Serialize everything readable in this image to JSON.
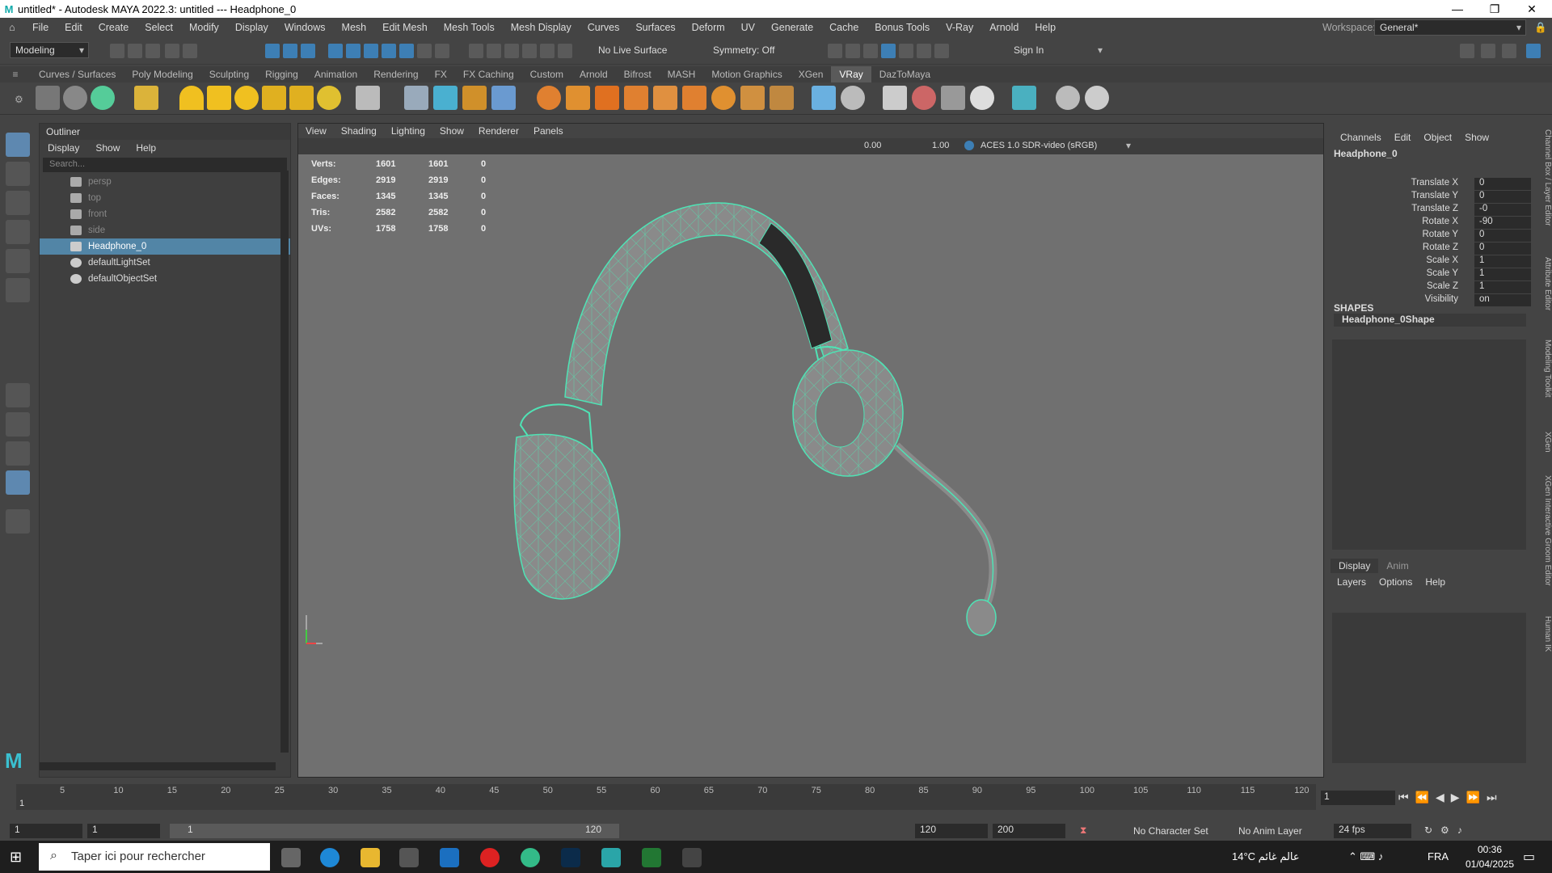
{
  "title": {
    "text": "untitled* - Autodesk MAYA 2022.3: untitled  ---  Headphone_0"
  },
  "menu": [
    "File",
    "Edit",
    "Create",
    "Select",
    "Modify",
    "Display",
    "Windows",
    "Mesh",
    "Edit Mesh",
    "Mesh Tools",
    "Mesh Display",
    "Curves",
    "Surfaces",
    "Deform",
    "UV",
    "Generate",
    "Cache",
    "Bonus Tools",
    "V-Ray",
    "Arnold",
    "Help"
  ],
  "workspace": {
    "label": "Workspace:",
    "value": "General*"
  },
  "toolbar": {
    "mode": "Modeling",
    "live_surface": "No Live Surface",
    "symmetry": "Symmetry: Off",
    "sign_in": "Sign In"
  },
  "shelf_tabs": [
    "Curves / Surfaces",
    "Poly Modeling",
    "Sculpting",
    "Rigging",
    "Animation",
    "Rendering",
    "FX",
    "FX Caching",
    "Custom",
    "Arnold",
    "Bifrost",
    "MASH",
    "Motion Graphics",
    "XGen",
    "VRay",
    "DazToMaya"
  ],
  "active_shelf": "VRay",
  "outliner": {
    "title": "Outliner",
    "menu": [
      "Display",
      "Show",
      "Help"
    ],
    "search_placeholder": "Search...",
    "items": [
      {
        "label": "persp",
        "state": "dim"
      },
      {
        "label": "top",
        "state": "dim"
      },
      {
        "label": "front",
        "state": "dim"
      },
      {
        "label": "side",
        "state": "dim"
      },
      {
        "label": "Headphone_0",
        "state": "selected"
      },
      {
        "label": "defaultLightSet",
        "state": "normal"
      },
      {
        "label": "defaultObjectSet",
        "state": "normal"
      }
    ]
  },
  "viewport": {
    "menu": [
      "View",
      "Shading",
      "Lighting",
      "Show",
      "Renderer",
      "Panels"
    ],
    "exposure": "0.00",
    "gamma": "1.00",
    "color_space": "ACES 1.0 SDR-video (sRGB)",
    "hud": [
      {
        "label": "Verts:",
        "a": "1601",
        "b": "1601",
        "c": "0"
      },
      {
        "label": "Edges:",
        "a": "2919",
        "b": "2919",
        "c": "0"
      },
      {
        "label": "Faces:",
        "a": "1345",
        "b": "1345",
        "c": "0"
      },
      {
        "label": "Tris:",
        "a": "2582",
        "b": "2582",
        "c": "0"
      },
      {
        "label": "UVs:",
        "a": "1758",
        "b": "1758",
        "c": "0"
      }
    ]
  },
  "channel_box": {
    "menu": [
      "Channels",
      "Edit",
      "Object",
      "Show"
    ],
    "object": "Headphone_0",
    "channels": [
      {
        "name": "Translate X",
        "value": "0"
      },
      {
        "name": "Translate Y",
        "value": "0"
      },
      {
        "name": "Translate Z",
        "value": "-0"
      },
      {
        "name": "Rotate X",
        "value": "-90"
      },
      {
        "name": "Rotate Y",
        "value": "0"
      },
      {
        "name": "Rotate Z",
        "value": "0"
      },
      {
        "name": "Scale X",
        "value": "1"
      },
      {
        "name": "Scale Y",
        "value": "1"
      },
      {
        "name": "Scale Z",
        "value": "1"
      },
      {
        "name": "Visibility",
        "value": "on"
      }
    ],
    "shapes_label": "SHAPES",
    "shape_name": "Headphone_0Shape"
  },
  "side_tabs": [
    "Channel Box / Layer Editor",
    "Attribute Editor",
    "Modeling Toolkit",
    "XGen",
    "XGen Interactive Groom Editor",
    "Human IK"
  ],
  "layer_editor": {
    "tabs": [
      "Display",
      "Anim"
    ],
    "menu": [
      "Layers",
      "Options",
      "Help"
    ]
  },
  "timeline": {
    "ticks": [
      "5",
      "10",
      "15",
      "20",
      "25",
      "30",
      "35",
      "40",
      "45",
      "50",
      "55",
      "60",
      "65",
      "70",
      "75",
      "80",
      "85",
      "90",
      "95",
      "100",
      "105",
      "110",
      "115",
      "120"
    ],
    "current_frame": "1",
    "playhead": "1"
  },
  "range": {
    "start": "1",
    "inner_start": "1",
    "slider_start": "1",
    "slider_end": "120",
    "end": "120",
    "max": "200",
    "char_set": "No Character Set",
    "anim_layer": "No Anim Layer",
    "fps": "24 fps"
  },
  "taskbar": {
    "search": "Taper ici pour rechercher",
    "weather": "14°C عالم غائم",
    "lang": "FRA",
    "time": "00:36",
    "date": "01/04/2025"
  }
}
